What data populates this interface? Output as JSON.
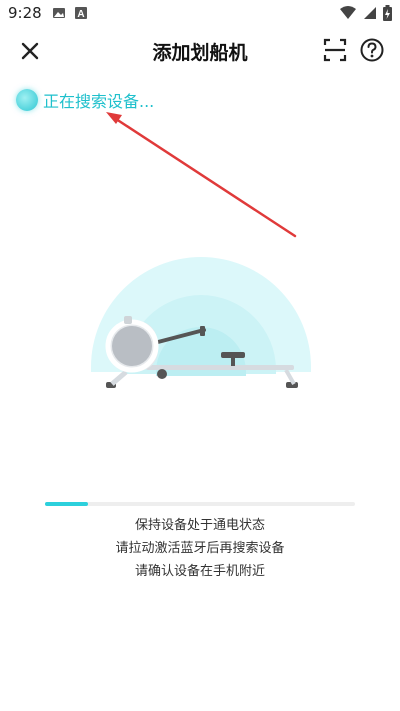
{
  "status_bar": {
    "time": "9:28",
    "left_icons": [
      "image-icon",
      "app-a-icon"
    ],
    "right_icons": [
      "wifi-icon",
      "cellular-icon",
      "battery-charging-icon"
    ]
  },
  "header": {
    "title": "添加划船机",
    "close_icon": "close-icon",
    "scan_icon": "scan-icon",
    "help_icon": "help-icon"
  },
  "search": {
    "status_text": "正在搜索设备..."
  },
  "progress": {
    "value": 0.14
  },
  "tips": [
    "保持设备处于通电状态",
    "请拉动激活蓝牙后再搜索设备",
    "请确认设备在手机附近"
  ],
  "colors": {
    "accent": "#2cd0dc",
    "search_text": "#1fc0cc",
    "annotation_arrow": "#e03a3a"
  }
}
